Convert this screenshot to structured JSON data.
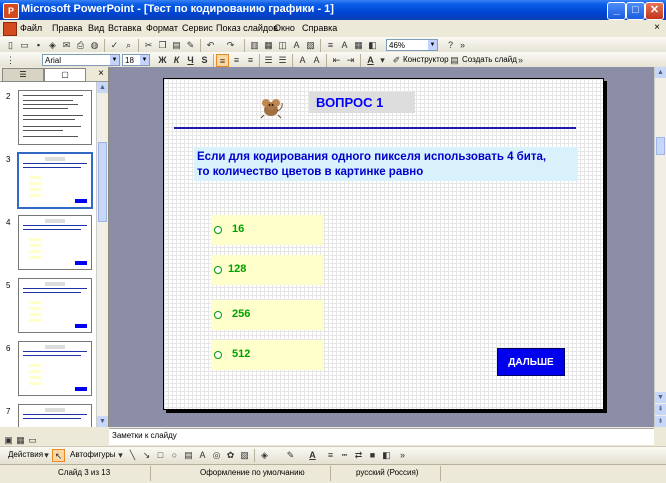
{
  "window": {
    "title": "Microsoft PowerPoint - [Тест по кодированию графики - 1]",
    "minimize": "_",
    "maximize": "□",
    "close": "✕"
  },
  "menu": {
    "items": [
      "Файл",
      "Правка",
      "Вид",
      "Вставка",
      "Формат",
      "Сервис",
      "Показ слайдов",
      "Окно",
      "Справка"
    ],
    "close": "×"
  },
  "toolbar": {
    "zoom": "46%",
    "font_name": "Arial",
    "font_size": "18",
    "bold": "Ж",
    "italic": "К",
    "underline": "Ч",
    "shadow": "S",
    "designer": "Конструктор",
    "new_slide": "Создать слайд"
  },
  "pane": {
    "tab_outline": "☰",
    "tab_slides": "▢",
    "close": "×",
    "slide_numbers": [
      "2",
      "3",
      "4",
      "5",
      "6",
      "7"
    ]
  },
  "slide": {
    "question_label": "ВОПРОС 1",
    "question_line1": "Если для кодирования одного пикселя использовать 4 бита,",
    "question_line2": "то количество цветов в картинке равно",
    "answers": [
      "16",
      "128",
      "256",
      "512"
    ],
    "next_button": "ДАЛЬШЕ"
  },
  "notes": {
    "placeholder": "Заметки к слайду"
  },
  "drawing": {
    "actions": "Действия",
    "autoshapes": "Автофигуры"
  },
  "status": {
    "slide": "Слайд 3 из 13",
    "design": "Оформление по умолчанию",
    "language": "русский (Россия)"
  },
  "colors": {
    "titlebar": "#0046D5",
    "question_text": "#0000CC",
    "answer_bg": "#FFFFCC",
    "answer_text": "#00A000",
    "next_button": "#0000EE"
  }
}
